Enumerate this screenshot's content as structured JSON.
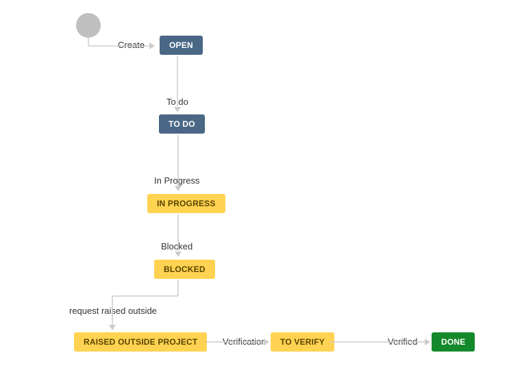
{
  "workflow": {
    "start": {
      "kind": "initial"
    },
    "states": {
      "open": {
        "label": "OPEN",
        "category": "blue"
      },
      "todo": {
        "label": "TO DO",
        "category": "blue"
      },
      "inprog": {
        "label": "IN PROGRESS",
        "category": "yellow"
      },
      "blocked": {
        "label": "BLOCKED",
        "category": "yellow"
      },
      "raised": {
        "label": "RAISED OUTSIDE PROJECT",
        "category": "yellow"
      },
      "verify": {
        "label": "TO VERIFY",
        "category": "yellow"
      },
      "done": {
        "label": "DONE",
        "category": "green"
      }
    },
    "transitions": {
      "create": {
        "label": "Create"
      },
      "todo": {
        "label": "To do"
      },
      "inprogress": {
        "label": "In Progress"
      },
      "blocked": {
        "label": "Blocked"
      },
      "raised": {
        "label": "request raised outside"
      },
      "verification": {
        "label": "Verification"
      },
      "verified": {
        "label": "Verified"
      }
    }
  }
}
